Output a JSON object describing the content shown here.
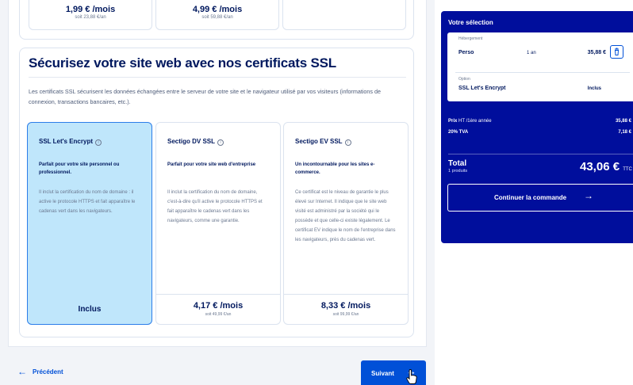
{
  "top_cards": [
    {
      "price": "1,99 € /mois",
      "sub": "soit 23,88 €/an"
    },
    {
      "price": "4,99 € /mois",
      "sub": "soit 59,88 €/an"
    }
  ],
  "ssl": {
    "title": "Sécurisez votre site web avec nos certificats SSL",
    "description": "Les certificats SSL sécurisent les données échangées entre le serveur de votre site et le navigateur utilisé par vos visiteurs (informations de connexion, transactions bancaires, etc.).",
    "offers": [
      {
        "name": "SSL Let's Encrypt",
        "tagline": "Parfait pour votre site personnel ou professionnel.",
        "body": "Il inclut la certification du nom de domaine : il active le protocole HTTPS et fait apparaître le cadenas vert dans les navigateurs.",
        "footer": "Inclus",
        "selected": true
      },
      {
        "name": "Sectigo DV SSL",
        "tagline": "Parfait pour votre site web d'entreprise",
        "body": "Il inclut la certification du nom de domaine, c'est-à-dire qu'il active le protocole HTTPS et fait apparaître le cadenas vert dans les navigateurs, comme une garantie.",
        "price": "4,17 € /mois",
        "price_sub": "soit 49,99 €/an"
      },
      {
        "name": "Sectigo EV SSL",
        "tagline": "Un incontournable pour les sites e-commerce.",
        "body": "Ce certificat est le niveau de garantie le plus élevé sur Internet. Il indique que le site web visité est administré par la société qui le possède et que celle-ci existe légalement. Le certificat EV indique le nom de l'entreprise dans les navigateurs, près du cadenas vert.",
        "price": "8,33 € /mois",
        "price_sub": "soit 99,99 €/an"
      }
    ]
  },
  "nav": {
    "prev_label": "Précédent",
    "next_label": "Suivant"
  },
  "selection": {
    "title": "Votre sélection",
    "hosting": {
      "label": "Hébergement",
      "name": "Perso",
      "duration": "1 an",
      "price": "35,88 €"
    },
    "option": {
      "label": "Option",
      "name": "SSL Let's Encrypt",
      "value": "Inclus"
    },
    "price_row": {
      "label_bold": "Prix",
      "label_rest": " HT /1ère année",
      "value": "35,88 €"
    },
    "tax_row": {
      "label": "20% TVA",
      "value": "7,18 €"
    },
    "total_label": "Total",
    "total_sub": "1 produits",
    "total_value": "43,06 €",
    "total_suffix": "TTC",
    "continue_label": "Continuer la commande"
  },
  "colors": {
    "panel": "#000e9c",
    "primary": "#0050d7",
    "selected_card": "#bfe6fb",
    "text": "#00185e"
  }
}
